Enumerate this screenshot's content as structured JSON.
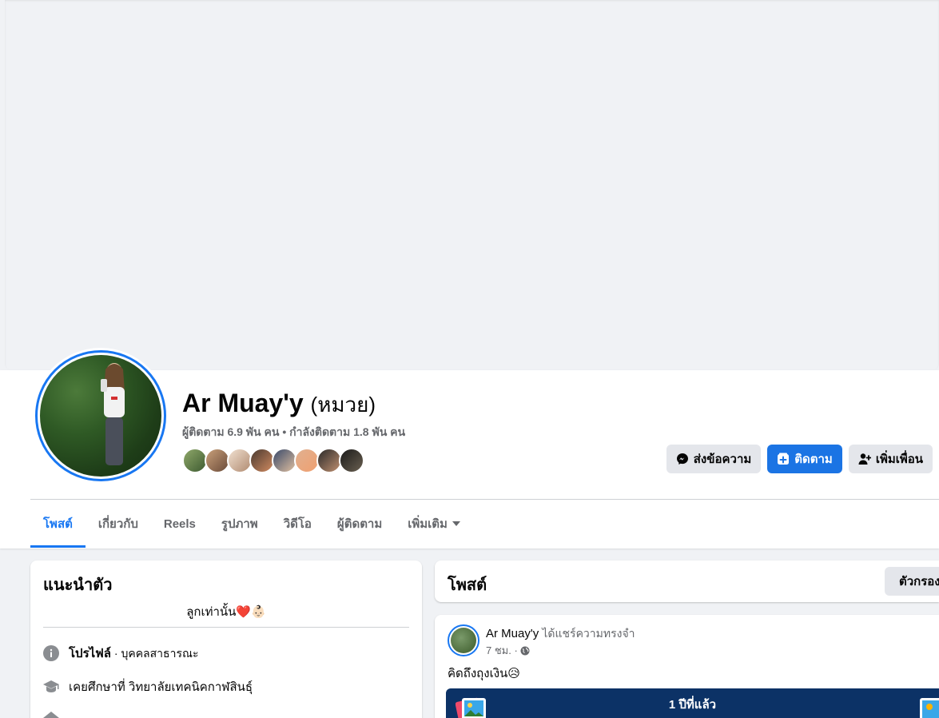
{
  "profile": {
    "name": "Ar Muay'y",
    "alt_name": "(หมวย)",
    "stats": "ผู้ติดตาม 6.9 พัน คน • กำลังติดตาม 1.8 พัน คน"
  },
  "actions": {
    "message_label": "ส่งข้อความ",
    "follow_label": "ติดตาม",
    "add_friend_label": "เพิ่มเพื่อน"
  },
  "tabs": [
    {
      "label": "โพสต์"
    },
    {
      "label": "เกี่ยวกับ"
    },
    {
      "label": "Reels"
    },
    {
      "label": "รูปภาพ"
    },
    {
      "label": "วิดีโอ"
    },
    {
      "label": "ผู้ติดตาม"
    },
    {
      "label": "เพิ่มเติม"
    }
  ],
  "intro": {
    "title": "แนะนำตัว",
    "bio": "ลูกเท่านั้น❤️👶🏻",
    "profile_label": "โปรไฟล์",
    "profile_type": " · บุคคลสาธารณะ",
    "education": "เคยศึกษาที่ วิทยาลัยเทคนิคกาฬสินธุ์"
  },
  "posts": {
    "title": "โพสต์",
    "filter_label": "ตัวกรอง"
  },
  "post": {
    "author": "Ar Muay'y",
    "action": "ได้แชร์ความทรงจำ",
    "time": "7 ชม. ·",
    "text": "คิดถึงถุงเงิน😥",
    "memory_label": "1 ปีที่แล้ว"
  },
  "colors": {
    "accent": "#1877f2",
    "follow_button": "#1b74e4",
    "memory_bg": "#0c3266"
  }
}
